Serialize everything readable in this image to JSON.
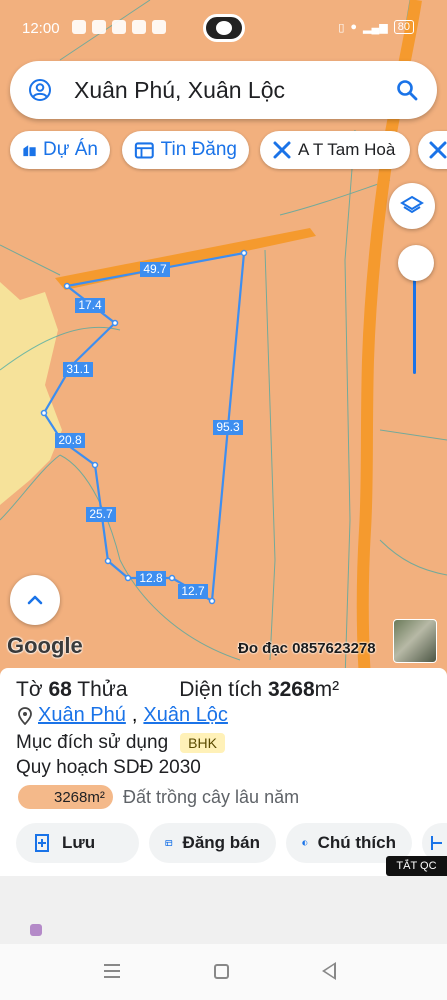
{
  "status_bar": {
    "time": "12:00",
    "battery": "80"
  },
  "search": {
    "title": "Xuân Phú, Xuân Lộc"
  },
  "chips": [
    {
      "label": "Dự Án",
      "icon": "building-icon"
    },
    {
      "label": "Tin Đăng",
      "icon": "listing-icon"
    },
    {
      "label": "A T Tam Hoà",
      "icon": "tools-icon"
    }
  ],
  "map": {
    "parcel_edges": [
      "49.7",
      "17.4",
      "31.1",
      "20.8",
      "25.7",
      "12.8",
      "12.7",
      "95.3"
    ],
    "google_label": "Google",
    "contact": "Đo đạc 0857623278"
  },
  "parcel": {
    "sheet_label": "Tờ",
    "sheet_no": "68",
    "plot_label": "Thửa",
    "area_label": "Diện tích",
    "area_value": "3268",
    "area_unit": "m²",
    "ward": "Xuân Phú",
    "district": "Xuân Lộc",
    "purpose_label": "Mục đích sử dụng",
    "purpose_code": "BHK",
    "planning_label": "Quy hoạch SDĐ 2030",
    "planning_area": "3268m²",
    "planning_type": "Đất trồng cây lâu năm"
  },
  "actions": [
    {
      "label": "Lưu",
      "icon": "add-bookmark-icon"
    },
    {
      "label": "Đăng bán",
      "icon": "post-sale-icon"
    },
    {
      "label": "Chú thích",
      "icon": "legend-icon"
    }
  ],
  "ad_tag": "TẮT QC",
  "colors": {
    "accent": "#1a73e8",
    "map_land": "#f2b07e",
    "road": "#f59a2e",
    "parcel_line": "#3d8ef0"
  }
}
